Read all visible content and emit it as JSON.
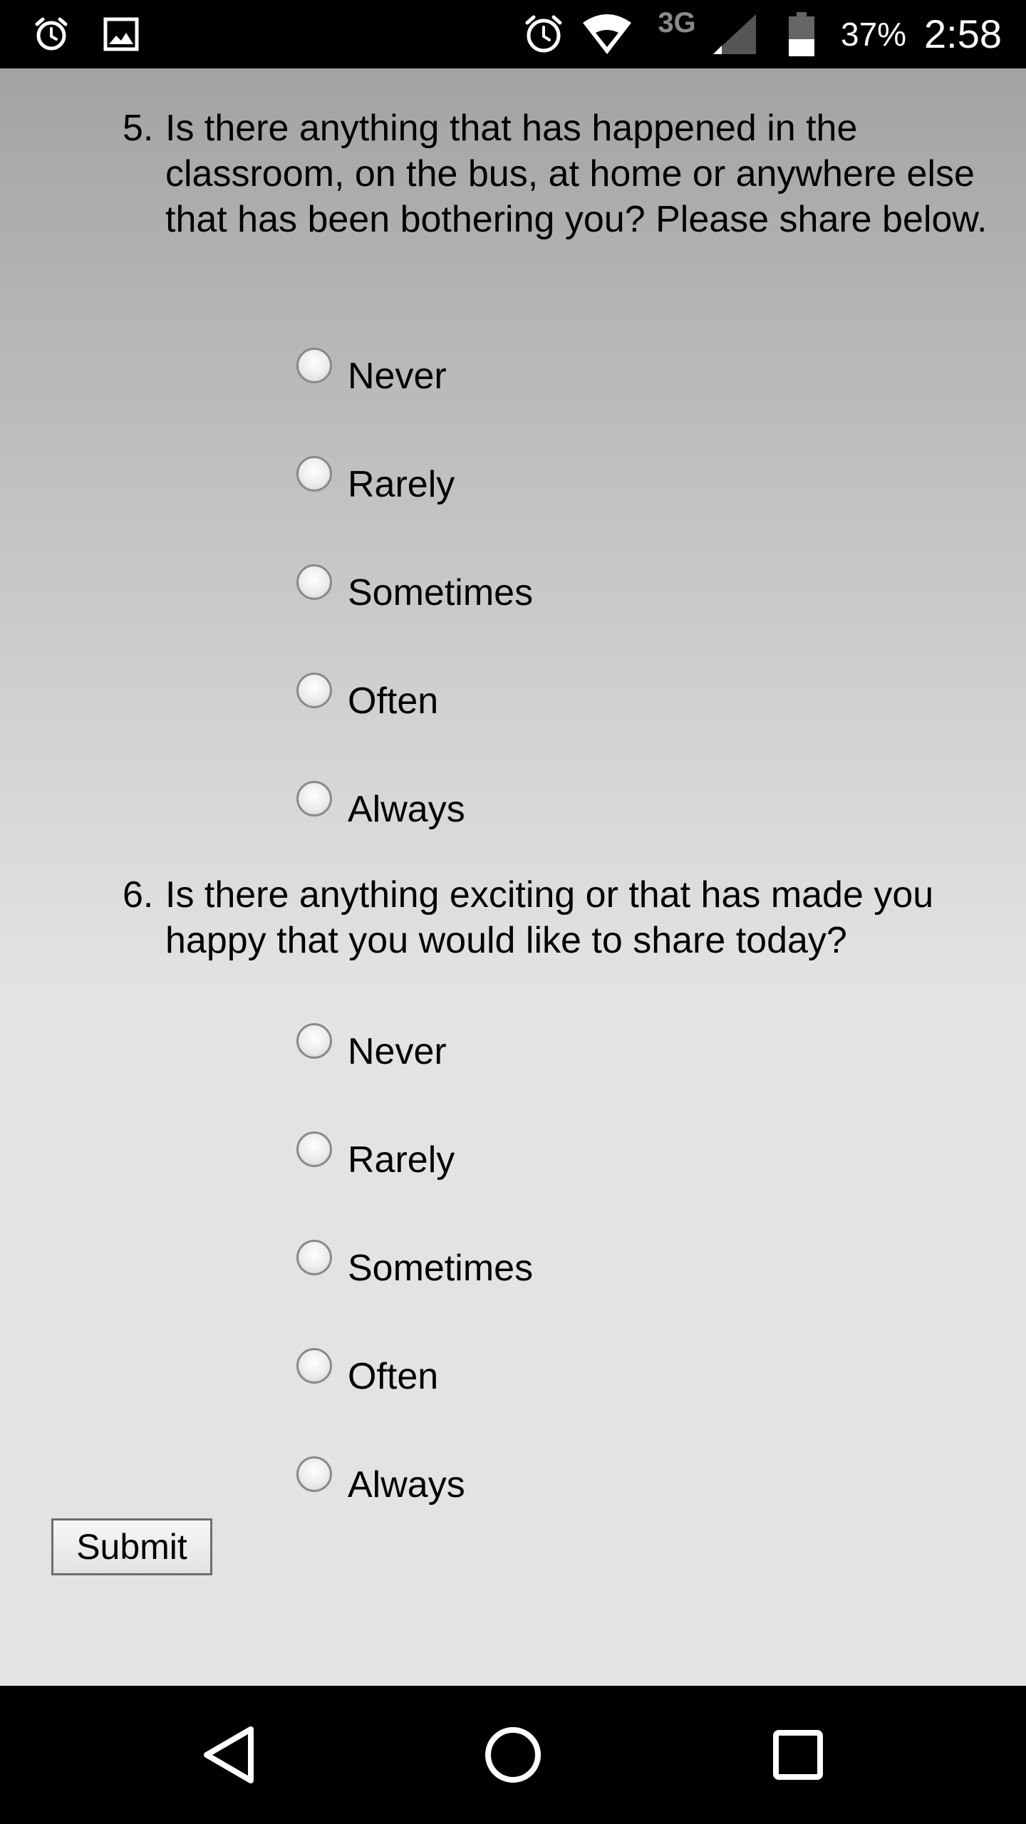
{
  "status_bar": {
    "icons": [
      "alarm-icon",
      "image-icon",
      "alarm-clock-icon",
      "wifi-icon",
      "network-3g-icon",
      "signal-icon",
      "battery-icon"
    ],
    "network_type": "3G",
    "battery_percent": "37%",
    "time": "2:58"
  },
  "questions": [
    {
      "number": "5.",
      "text": "Is there anything that has happened in the classroom, on the bus, at home or anywhere else that has been bothering you? Please share below.",
      "options": [
        "Never",
        "Rarely",
        "Sometimes",
        "Often",
        "Always"
      ]
    },
    {
      "number": "6.",
      "text": "Is there anything exciting or that has made you happy that you would like to share today?",
      "options": [
        "Never",
        "Rarely",
        "Sometimes",
        "Often",
        "Always"
      ]
    }
  ],
  "submit_label": "Submit",
  "nav_bar": {
    "icons": [
      "back-icon",
      "home-icon",
      "recents-icon"
    ]
  }
}
